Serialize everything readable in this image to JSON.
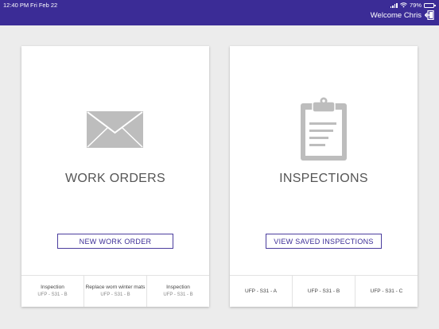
{
  "status_bar": {
    "time": "12:40 PM",
    "date": "Fri Feb 22",
    "battery": "79%",
    "battery_level": 0.79
  },
  "header": {
    "welcome": "Welcome Chris",
    "background_color": "#3b2c96"
  },
  "work_orders": {
    "title": "WORK ORDERS",
    "icon": "envelope-icon",
    "button_label": "NEW WORK ORDER",
    "recent": [
      {
        "label": "Inspection",
        "sub": "UFP - S31 - B"
      },
      {
        "label": "Replace worn winter mats",
        "sub": "UFP - S31 - B"
      },
      {
        "label": "Inspection",
        "sub": "UFP - S31 - B"
      }
    ]
  },
  "inspections": {
    "title": "INSPECTIONS",
    "icon": "clipboard-icon",
    "button_label": "VIEW SAVED INSPECTIONS",
    "recent": [
      {
        "label": "UFP - S31 - A"
      },
      {
        "label": "UFP - S31 - B"
      },
      {
        "label": "UFP - S31 - C"
      }
    ]
  }
}
